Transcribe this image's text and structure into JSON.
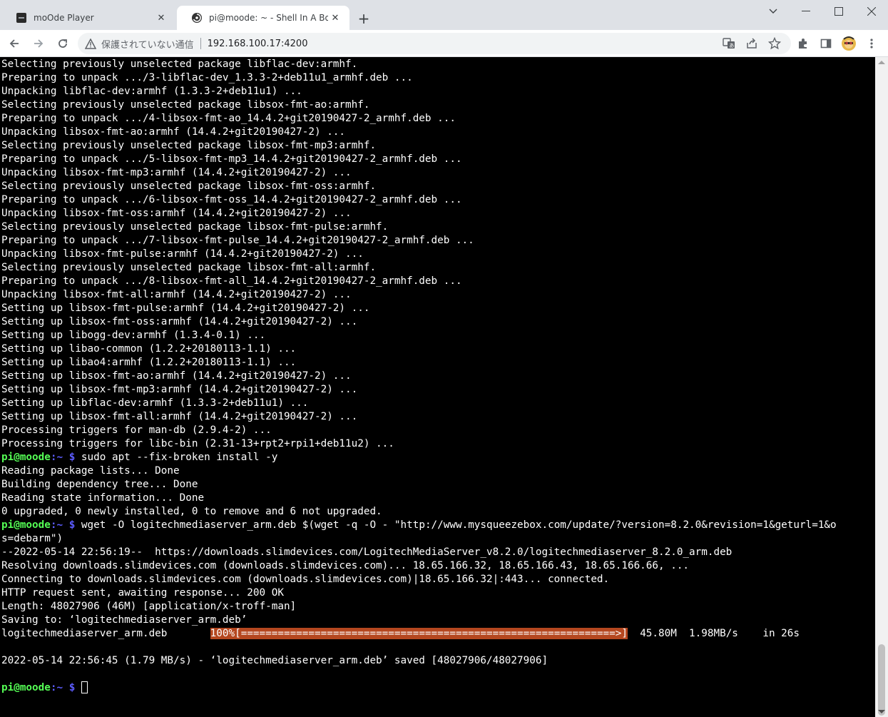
{
  "tabs": [
    {
      "title": "moOde Player",
      "icon": "moode-favicon"
    },
    {
      "title": "pi@moode: ~ - Shell In A Box",
      "icon": "shellinabox-favicon"
    }
  ],
  "address_bar": {
    "security_label": "保護されていない通信",
    "url": "192.168.100.17:4200"
  },
  "terminal": {
    "prompt_user": "pi@moode",
    "prompt_path": ":~",
    "prompt_symbol": "$",
    "log_lines": [
      "Selecting previously unselected package libflac-dev:armhf.",
      "Preparing to unpack .../3-libflac-dev_1.3.3-2+deb11u1_armhf.deb ...",
      "Unpacking libflac-dev:armhf (1.3.3-2+deb11u1) ...",
      "Selecting previously unselected package libsox-fmt-ao:armhf.",
      "Preparing to unpack .../4-libsox-fmt-ao_14.4.2+git20190427-2_armhf.deb ...",
      "Unpacking libsox-fmt-ao:armhf (14.4.2+git20190427-2) ...",
      "Selecting previously unselected package libsox-fmt-mp3:armhf.",
      "Preparing to unpack .../5-libsox-fmt-mp3_14.4.2+git20190427-2_armhf.deb ...",
      "Unpacking libsox-fmt-mp3:armhf (14.4.2+git20190427-2) ...",
      "Selecting previously unselected package libsox-fmt-oss:armhf.",
      "Preparing to unpack .../6-libsox-fmt-oss_14.4.2+git20190427-2_armhf.deb ...",
      "Unpacking libsox-fmt-oss:armhf (14.4.2+git20190427-2) ...",
      "Selecting previously unselected package libsox-fmt-pulse:armhf.",
      "Preparing to unpack .../7-libsox-fmt-pulse_14.4.2+git20190427-2_armhf.deb ...",
      "Unpacking libsox-fmt-pulse:armhf (14.4.2+git20190427-2) ...",
      "Selecting previously unselected package libsox-fmt-all:armhf.",
      "Preparing to unpack .../8-libsox-fmt-all_14.4.2+git20190427-2_armhf.deb ...",
      "Unpacking libsox-fmt-all:armhf (14.4.2+git20190427-2) ...",
      "Setting up libsox-fmt-pulse:armhf (14.4.2+git20190427-2) ...",
      "Setting up libsox-fmt-oss:armhf (14.4.2+git20190427-2) ...",
      "Setting up libogg-dev:armhf (1.3.4-0.1) ...",
      "Setting up libao-common (1.2.2+20180113-1.1) ...",
      "Setting up libao4:armhf (1.2.2+20180113-1.1) ...",
      "Setting up libsox-fmt-ao:armhf (14.4.2+git20190427-2) ...",
      "Setting up libsox-fmt-mp3:armhf (14.4.2+git20190427-2) ...",
      "Setting up libflac-dev:armhf (1.3.3-2+deb11u1) ...",
      "Setting up libsox-fmt-all:armhf (14.4.2+git20190427-2) ...",
      "Processing triggers for man-db (2.9.4-2) ...",
      "Processing triggers for libc-bin (2.31-13+rpt2+rpi1+deb11u2) ..."
    ],
    "cmd1": "sudo apt --fix-broken install -y",
    "cmd1_output": [
      "Reading package lists... Done",
      "Building dependency tree... Done",
      "Reading state information... Done",
      "0 upgraded, 0 newly installed, 0 to remove and 6 not upgraded."
    ],
    "cmd2_line1": "wget -O logitechmediaserver_arm.deb $(wget -q -O - \"http://www.mysqueezebox.com/update/?version=8.2.0&revision=1&geturl=1&o",
    "cmd2_line2": "s=debarm\")",
    "cmd2_output": [
      "--2022-05-14 22:56:19--  https://downloads.slimdevices.com/LogitechMediaServer_v8.2.0/logitechmediaserver_8.2.0_arm.deb",
      "Resolving downloads.slimdevices.com (downloads.slimdevices.com)... 18.65.166.32, 18.65.166.43, 18.65.166.66, ...",
      "Connecting to downloads.slimdevices.com (downloads.slimdevices.com)|18.65.166.32|:443... connected.",
      "HTTP request sent, awaiting response... 200 OK",
      "Length: 48027906 (46M) [application/x-troff-man]",
      "Saving to: ‘logitechmediaserver_arm.deb’"
    ],
    "progress": {
      "file": "logitechmediaserver_arm.deb",
      "gap": "       ",
      "bar": "100%[=============================================================>]",
      "stats": "  45.80M  1.98MB/s    in 26s"
    },
    "saved_line": "2022-05-14 22:56:45 (1.79 MB/s) - ‘logitechmediaserver_arm.deb’ saved [48027906/48027906]"
  }
}
